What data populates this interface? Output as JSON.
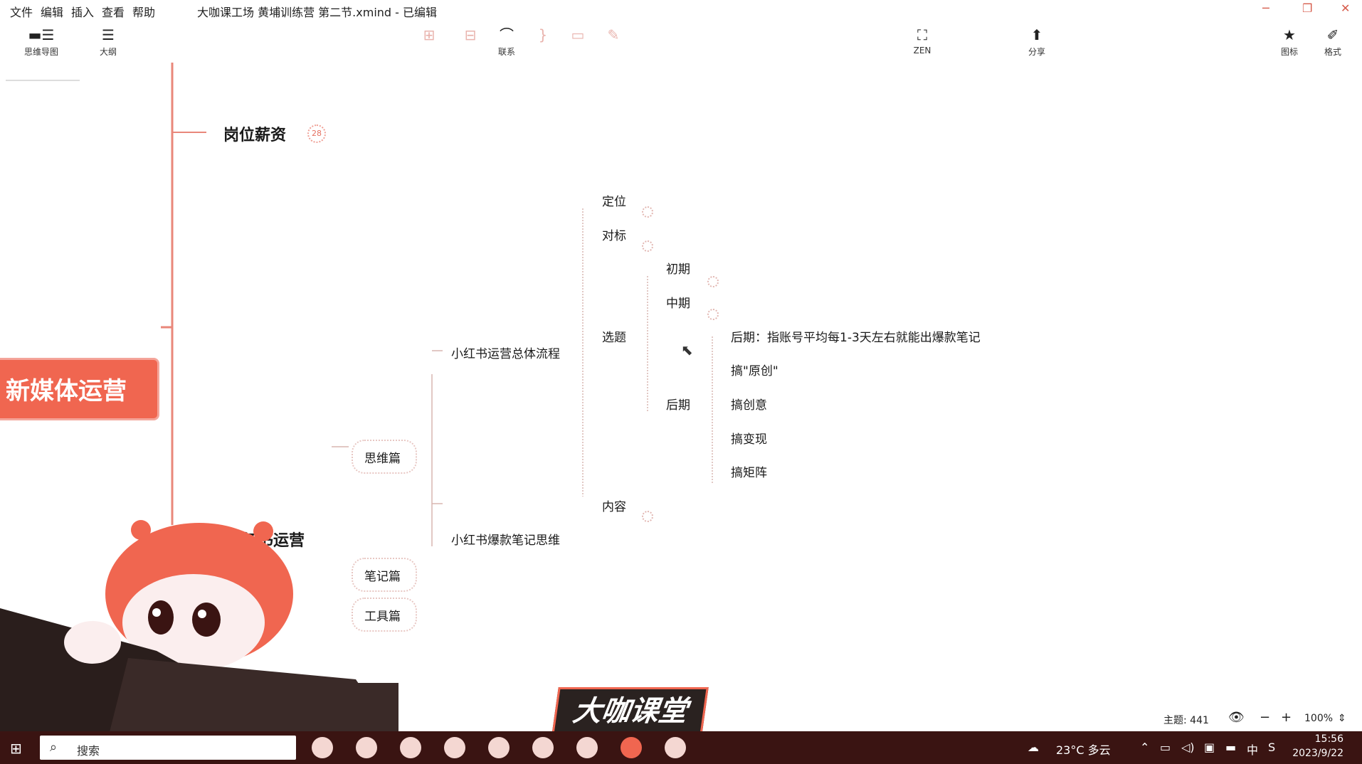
{
  "menu": {
    "items": [
      "文件",
      "编辑",
      "插入",
      "查看",
      "帮助"
    ],
    "window_title": "大咖课工场 黄埔训练营 第二节.xmind - 已编辑"
  },
  "toolbar": {
    "mindmap_label": "思维导图",
    "outline_label": "大纲",
    "relation_label": "联系",
    "zen_label": "ZEN",
    "share_label": "分享",
    "icons_label": "图标",
    "format_label": "格式"
  },
  "mindmap": {
    "central": "新媒体运营",
    "branch_salary": "岗位薪资",
    "salary_badge": "28",
    "branch_xhs": "小红书运营",
    "siwei": "思维篇",
    "biji": "笔记篇",
    "gongju": "工具篇",
    "process": "小红书运营总体流程",
    "hit_notes": "小红书爆款笔记思维",
    "dingwei": "定位",
    "duibiao": "对标",
    "xuanti": "选题",
    "neirong": "内容",
    "chuqi": "初期",
    "zhongqi": "中期",
    "houqi": "后期",
    "houqi_note": "后期：指账号平均每1-3天左右就能出爆款笔记",
    "yuanchuang": "搞\"原创\"",
    "chuangyi": "搞创意",
    "bianxian": "搞变现",
    "juzhen": "搞矩阵"
  },
  "status": {
    "topic_count": "主题: 441",
    "zoom": "100%"
  },
  "watermark": "大咖课堂",
  "taskbar": {
    "search_placeholder": "搜索",
    "weather": "23°C 多云",
    "ime": "中",
    "time": "15:56",
    "date": "2023/9/22"
  },
  "colors": {
    "accent": "#f06650",
    "taskbar": "#3a1412"
  }
}
